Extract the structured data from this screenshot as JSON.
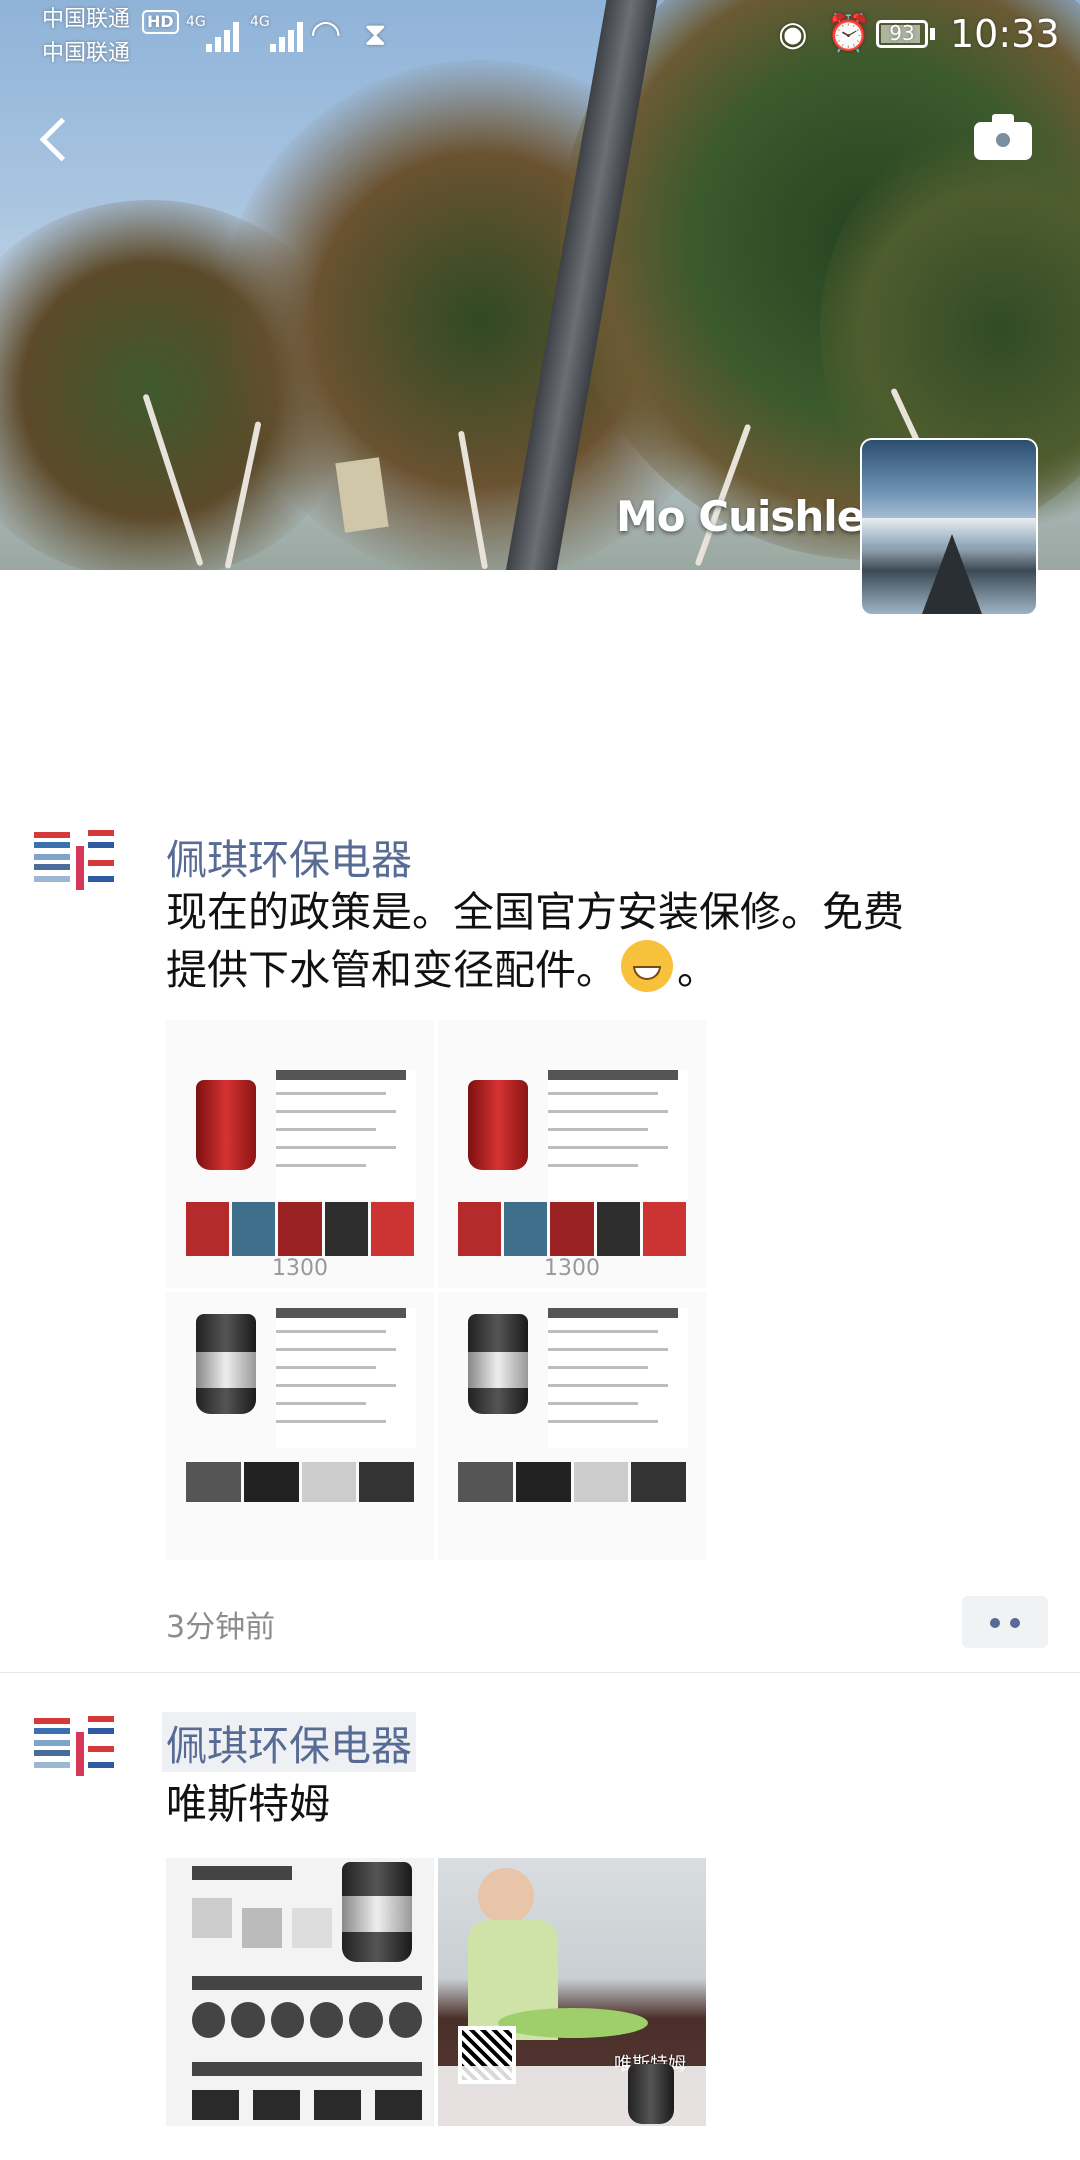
{
  "status_bar": {
    "carrier_1": "中国联通",
    "carrier_2": "中国联通",
    "hd_badge": "HD",
    "signal_1": "4G",
    "signal_2": "4G",
    "battery": "93",
    "battery_level": 0.93,
    "time": "10:33",
    "icons": [
      "wifi-icon",
      "hourglass-icon",
      "eye-icon",
      "alarm-icon",
      "battery-icon"
    ]
  },
  "cover": {
    "username": "Mo Cuishle",
    "icons": [
      "back-icon",
      "camera-icon"
    ]
  },
  "posts": [
    {
      "author": "佩琪环保电器",
      "text_line_1": "现在的政策是。全国官方安装保修。免费",
      "text_line_2_before_emoji": "提供下水管和变径配件。",
      "text_line_2_after_emoji": "。",
      "emoji": "grinning-face-emoji",
      "images": [
        {
          "model": "1300"
        },
        {
          "model": "1300"
        },
        {
          "model": ""
        },
        {
          "model": ""
        }
      ],
      "time": "3分钟前",
      "more_icon": "more-dots-icon"
    },
    {
      "author": "佩琪环保电器",
      "text": "唯斯特姆",
      "images": [
        {
          "caption": ""
        },
        {
          "caption": "唯斯特姆"
        }
      ]
    }
  ],
  "colors": {
    "link_blue": "#576b95",
    "timestamp_gray": "#8c8c8c",
    "divider": "#e6e6e6"
  }
}
